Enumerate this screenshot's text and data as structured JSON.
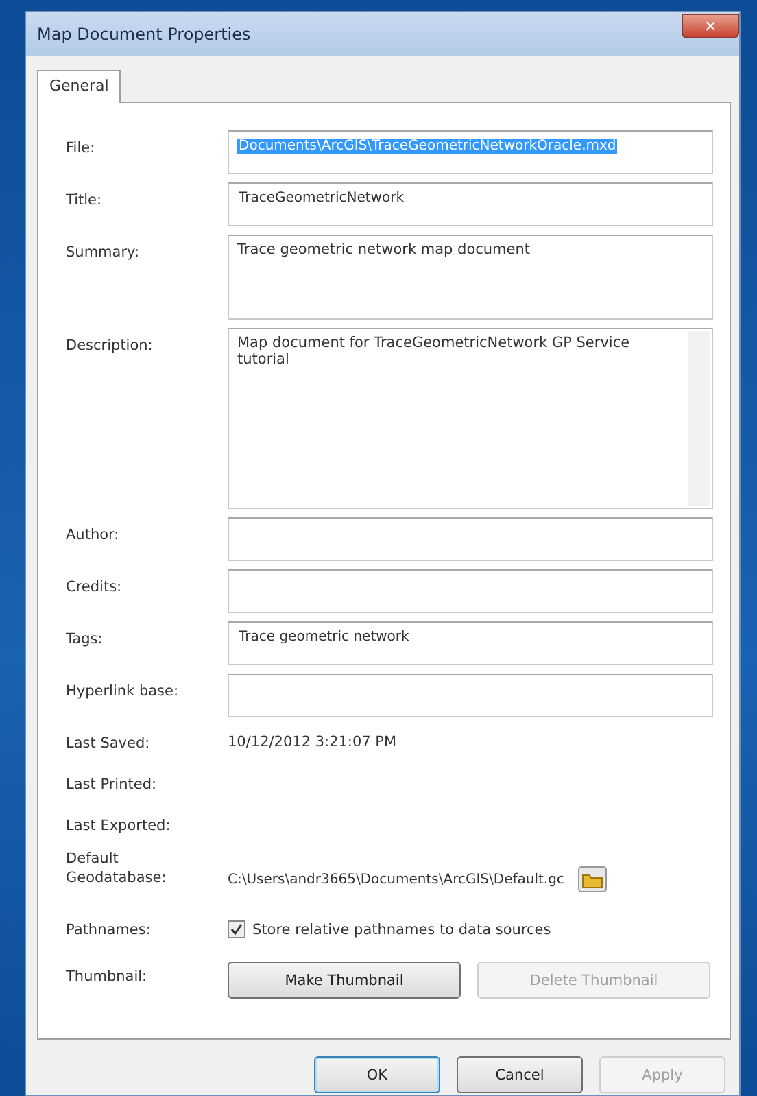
{
  "window": {
    "title": "Map Document Properties",
    "close": "✕"
  },
  "tabs": [
    {
      "label": "General",
      "selected": true
    }
  ],
  "fields": [
    {
      "label": "File:",
      "kind": "line",
      "value": "Documents\\ArcGIS\\TraceGeometricNetworkOracle.mxd",
      "highlighted": true
    },
    {
      "label": "Title:",
      "kind": "line",
      "value": "TraceGeometricNetwork"
    },
    {
      "label": "Summary:",
      "kind": "box",
      "value": "Trace geometric network map document"
    },
    {
      "label": "Description:",
      "kind": "memo",
      "value": "Map document for TraceGeometricNetwork GP Service tutorial"
    },
    {
      "label": "Author:",
      "kind": "line"
    },
    {
      "label": "Credits:",
      "kind": "line"
    },
    {
      "label": "Tags:",
      "kind": "line",
      "value": "Trace geometric network"
    },
    {
      "label": "Hyperlink base:",
      "kind": "line"
    },
    {
      "label": "Last Saved:",
      "kind": "info",
      "value": "10/12/2012 3:21:07 PM"
    },
    {
      "label": "Last Printed:",
      "kind": "info"
    },
    {
      "label": "Last Exported:",
      "kind": "info"
    },
    {
      "label": "Default Geodatabase:",
      "kind": "path",
      "value": "C:\\Users\\andr3665\\Documents\\ArcGIS\\Default.gc"
    },
    {
      "label": "Pathnames:",
      "kind": "checkbox",
      "value": "Store relative pathnames to data sources",
      "checked": true
    },
    {
      "label": "Thumbnail:",
      "kind": "buttons",
      "buttons": [
        {
          "label": "Make Thumbnail",
          "disabled": false
        },
        {
          "label": "Delete Thumbnail",
          "disabled": true
        }
      ]
    }
  ],
  "buttons": [
    {
      "label": "OK",
      "default": true,
      "disabled": false
    },
    {
      "label": "Cancel",
      "default": false,
      "disabled": false
    },
    {
      "label": "Apply",
      "default": false,
      "disabled": true
    }
  ]
}
